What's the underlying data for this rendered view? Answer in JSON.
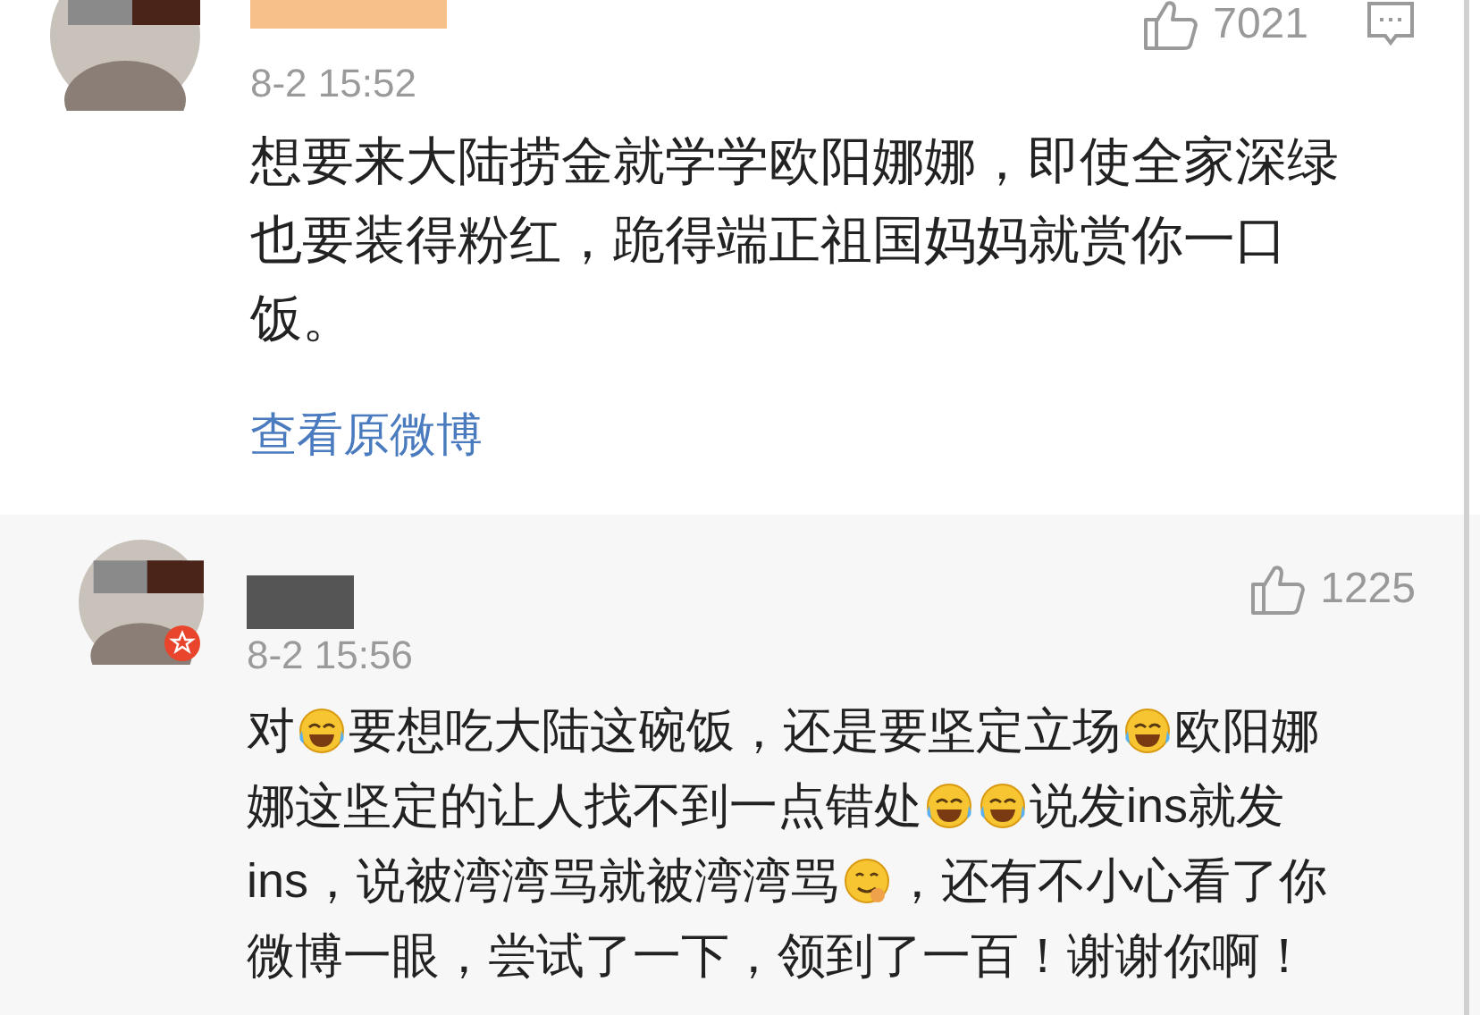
{
  "comments": [
    {
      "time": "8-2 15:52",
      "likes": "7021",
      "has_reply_icon": true,
      "badge": false,
      "lines": [
        [
          {
            "kind": "text",
            "text": "想要来大陆捞金就学学欧阳娜娜，即使全家深绿"
          }
        ],
        [
          {
            "kind": "text",
            "text": "也要装得粉红，跪得端正祖国妈妈就赏你一口"
          }
        ],
        [
          {
            "kind": "text",
            "text": "饭。"
          }
        ]
      ],
      "link": "查看原微博"
    },
    {
      "time": "8-2 15:56",
      "likes": "1225",
      "has_reply_icon": false,
      "badge": true,
      "lines": [
        [
          {
            "kind": "text",
            "text": "对"
          },
          {
            "kind": "laugh"
          },
          {
            "kind": "text",
            "text": "要想吃大陆这碗饭，还是要坚定立场"
          },
          {
            "kind": "laugh"
          },
          {
            "kind": "text",
            "text": "欧阳娜"
          }
        ],
        [
          {
            "kind": "text",
            "text": "娜这坚定的让人找不到一点错处"
          },
          {
            "kind": "laugh"
          },
          {
            "kind": "laugh"
          },
          {
            "kind": "text",
            "text": "说发ins就发"
          }
        ],
        [
          {
            "kind": "text",
            "text": "ins，说被湾湾骂就被湾湾骂"
          },
          {
            "kind": "yum"
          },
          {
            "kind": "text",
            "text": "，还有不小心看了你"
          }
        ],
        [
          {
            "kind": "text",
            "text": "微博一眼，尝试了一下，领到了一百！谢谢你啊！"
          }
        ]
      ]
    }
  ]
}
